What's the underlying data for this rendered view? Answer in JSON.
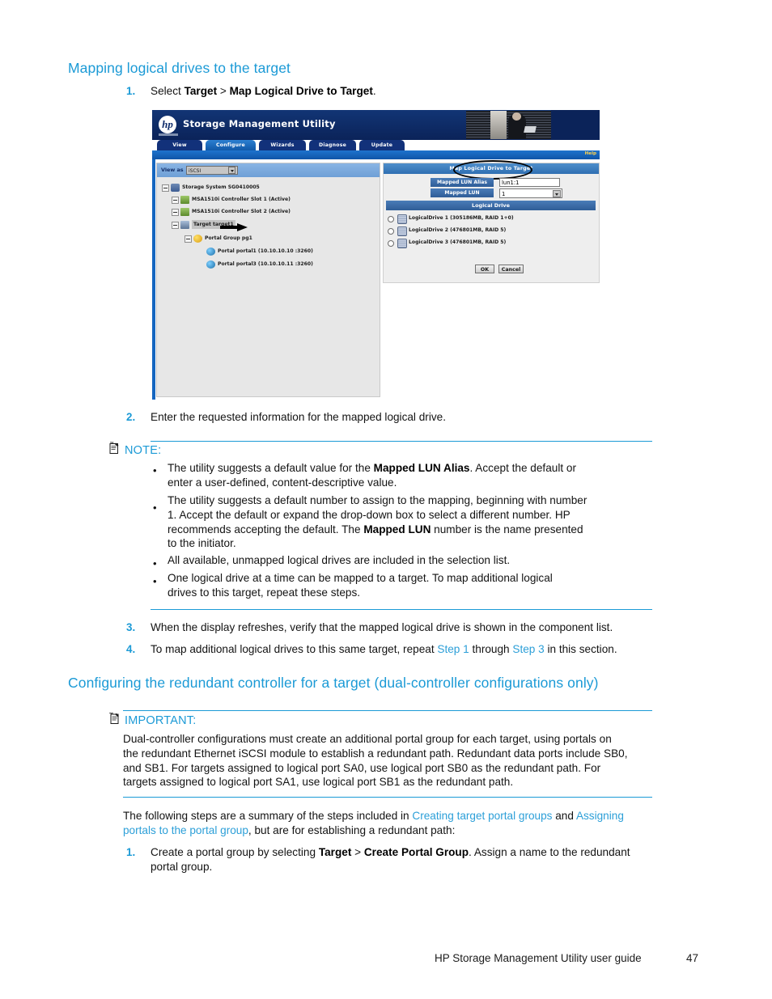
{
  "doc": {
    "section_heading": "Mapping logical drives to the target",
    "step1": {
      "number": "1.",
      "pre": "Select ",
      "bold1": "Target",
      "mid": " > ",
      "bold2": "Map Logical Drive to Target",
      "post": "."
    },
    "step2": {
      "number": "2.",
      "text": "Enter the requested information for the mapped logical drive."
    },
    "note": {
      "label": "NOTE:",
      "bullets": [
        {
          "l1_pre": "The utility suggests a default value for the ",
          "l1_bold": "Mapped LUN Alias",
          "l1_post": ".  Accept the default or",
          "l2": "enter a user-defined, content-descriptive value."
        },
        {
          "l1": "The utility suggests a default number to assign to the mapping, beginning with number",
          "l2": "1.  Accept the default or expand the drop-down box to select a different number.  HP",
          "l3_pre": "recommends accepting the default.  The ",
          "l3_bold": "Mapped LUN",
          "l3_post": " number is the name presented",
          "l4": "to the initiator."
        },
        {
          "l1": "All available, unmapped logical drives are included in the selection list."
        },
        {
          "l1": "One logical drive at a time can be mapped to a target.  To map additional logical",
          "l2": "drives to this target, repeat these steps."
        }
      ]
    },
    "step3": {
      "number": "3.",
      "text": "When the display refreshes, verify that the mapped logical drive is shown in the component list."
    },
    "step4": {
      "number": "4.",
      "pre": "To map additional logical drives to this same target, repeat ",
      "link1": "Step 1",
      "mid": " through ",
      "link2": "Step 3",
      "post": " in this section."
    },
    "section_heading2": "Configuring the redundant controller for a target (dual-controller configurations only)",
    "important": {
      "label": "IMPORTANT:",
      "lines": [
        "Dual-controller configurations must create an additional portal group for each target, using portals on",
        "the redundant Ethernet iSCSI module to establish a redundant path.  Redundant data ports include SB0,",
        "and SB1.  For targets assigned to logical port SA0, use logical port SB0 as the redundant path.  For",
        "targets assigned to logical port SA1, use logical port SB1 as the redundant path."
      ]
    },
    "summary": {
      "l1_pre": "The following steps are a summary of the steps included in ",
      "l1_link1": "Creating target portal groups",
      "l1_mid": " and ",
      "l1_link2": "Assigning",
      "l2_link": "portals to the portal group",
      "l2_post": ", but are for establishing a redundant path:"
    },
    "step5": {
      "number": "1.",
      "l1_pre": "Create a portal group by selecting ",
      "l1_bold1": "Target",
      "l1_mid": " > ",
      "l1_bold2": "Create Portal Group",
      "l1_post": ".  Assign a name to the redundant",
      "l2": "portal group."
    },
    "footer": {
      "title": "HP Storage Management Utility user guide",
      "page": "47"
    }
  },
  "app": {
    "brand": "hp",
    "title": "Storage Management Utility",
    "help_label": "Help",
    "tabs": [
      {
        "label": "View",
        "active": false
      },
      {
        "label": "Configure",
        "active": true
      },
      {
        "label": "Wizards",
        "active": false
      },
      {
        "label": "Diagnose",
        "active": false
      },
      {
        "label": "Update",
        "active": false
      }
    ],
    "tree_panel": {
      "view_as_label": "View as",
      "view_as_value": "iSCSI",
      "nodes": [
        {
          "label": "Storage System SG0410005",
          "icon": "system"
        },
        {
          "label": "MSA1510i Controller Slot 1 (Active)",
          "icon": "controller"
        },
        {
          "label": "MSA1510i Controller Slot 2 (Active)",
          "icon": "controller"
        },
        {
          "label": "Target target1",
          "icon": "target",
          "selected": true
        },
        {
          "label": "Portal Group pg1",
          "icon": "portal-group"
        },
        {
          "label": "Portal portal1 (10.10.10.10 :3260)",
          "icon": "portal"
        },
        {
          "label": "Portal portal3 (10.10.10.11 :3260)",
          "icon": "portal"
        }
      ]
    },
    "dialog": {
      "title": "Map Logical Drive to Target",
      "mapped_lun_alias_label": "Mapped LUN Alias",
      "mapped_lun_alias_value": "lun1:1",
      "mapped_lun_label": "Mapped LUN",
      "mapped_lun_value": "1",
      "logical_drive_header": "Logical Drive",
      "drives": [
        {
          "label": "LogicalDrive 1 (305186MB, RAID 1+0)",
          "selected": false
        },
        {
          "label": "LogicalDrive 2 (476801MB, RAID 5)",
          "selected": false
        },
        {
          "label": "LogicalDrive 3 (476801MB, RAID 5)",
          "selected": false
        }
      ],
      "ok_label": "OK",
      "cancel_label": "Cancel"
    }
  }
}
